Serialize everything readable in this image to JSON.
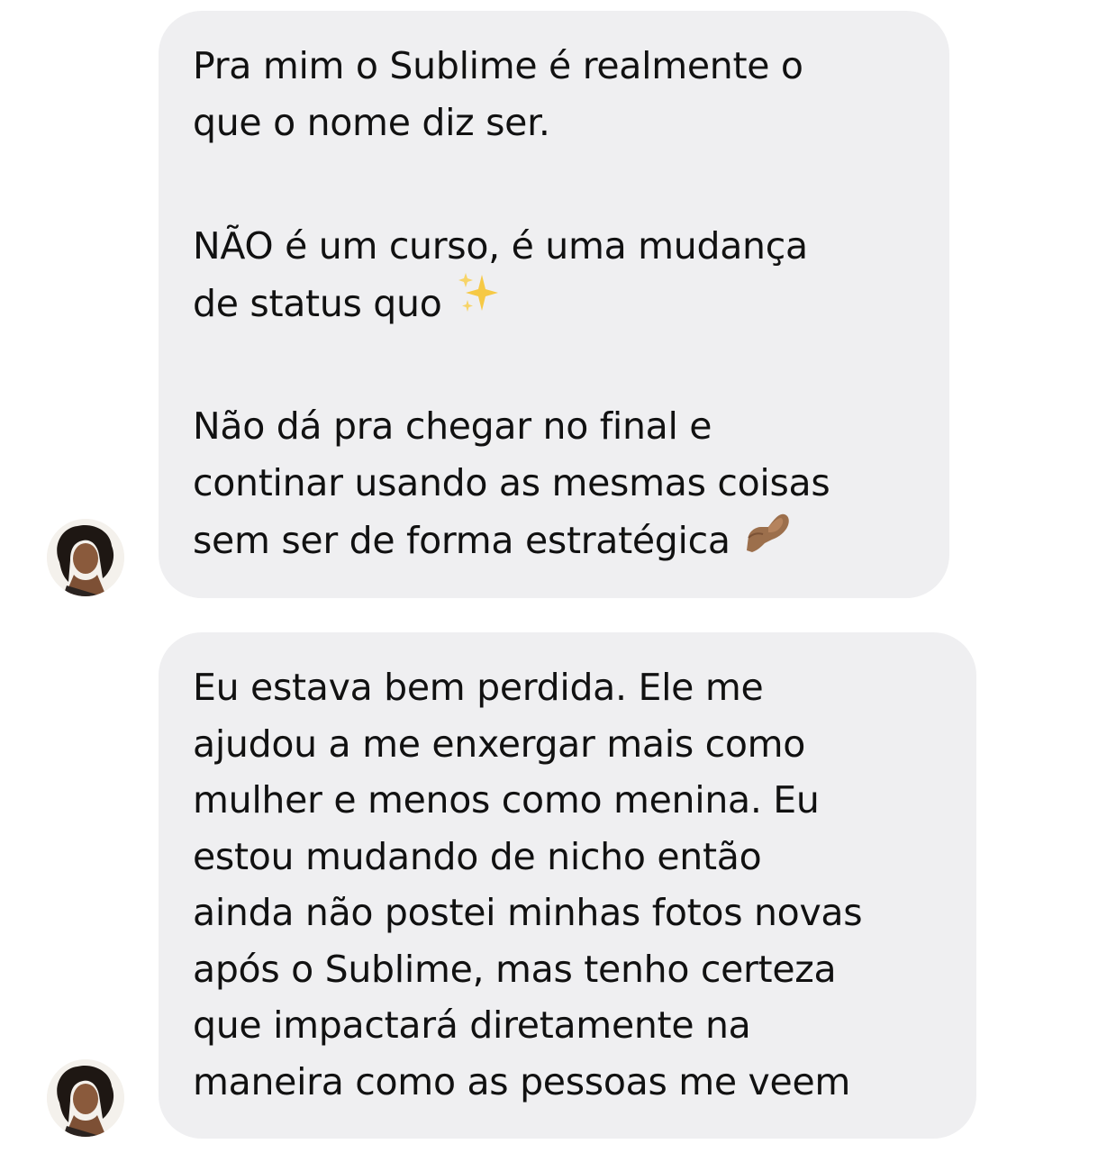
{
  "messages": [
    {
      "sender": "contact",
      "paragraphs": [
        {
          "lines": [
            "Pra mim o Sublime é realmente o",
            "que o nome diz ser."
          ]
        },
        {
          "lines": [
            "NÃO é um curso, é uma mudança",
            "de status quo"
          ],
          "emoji": "sparkles-emoji"
        },
        {
          "lines": [
            "Não dá pra chegar no final e",
            "continar usando as mesmas coisas",
            "sem ser de forma estratégica"
          ],
          "emoji": "pinched-fingers-emoji"
        }
      ]
    },
    {
      "sender": "contact",
      "paragraphs": [
        {
          "lines": [
            "Eu estava bem perdida. Ele me",
            "ajudou a me enxergar mais como",
            "mulher e menos como menina. Eu",
            "estou mudando de nicho então",
            "ainda não postei minhas fotos novas",
            "após o Sublime, mas tenho certeza",
            "que impactará diretamente na",
            "maneira como as pessoas me veem"
          ]
        }
      ]
    }
  ],
  "colors": {
    "bubble_background": "#efeff1",
    "text": "#111111",
    "background": "#ffffff"
  }
}
